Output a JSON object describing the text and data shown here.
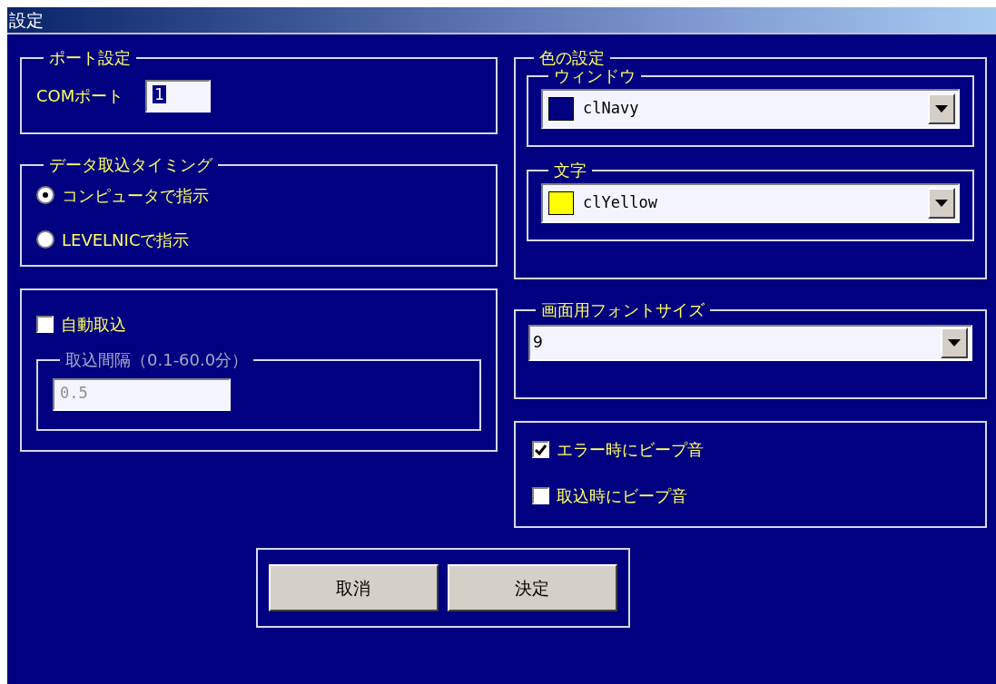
{
  "window": {
    "title": "設定"
  },
  "port_settings": {
    "title": "ポート設定",
    "com_port": {
      "label": "COMポート",
      "value": "1",
      "text_selected": true
    }
  },
  "data_timing": {
    "title": "データ取込タイミング",
    "options": [
      {
        "label": "コンピュータで指示",
        "selected": true
      },
      {
        "label": "LEVELNICで指示",
        "selected": false
      }
    ]
  },
  "auto_import": {
    "checkbox": {
      "label": "自動取込",
      "checked": false
    },
    "interval": {
      "title": "取込間隔（0.1-60.0分）",
      "value": "0.5",
      "disabled": true
    }
  },
  "color_settings": {
    "title": "色の設定",
    "groups": [
      {
        "title": "ウィンドウ",
        "value": "clNavy",
        "color": "#000080"
      },
      {
        "title": "文字",
        "value": "clYellow",
        "color": "#ffff00"
      }
    ]
  },
  "font_size": {
    "title": "画面用フォントサイズ",
    "value": "9"
  },
  "beeps": [
    {
      "label": "エラー時にビープ音",
      "checked": true
    },
    {
      "label": "取込時にビープ音",
      "checked": false
    }
  ],
  "buttons": [
    {
      "label": "取消"
    },
    {
      "label": "決定"
    }
  ]
}
